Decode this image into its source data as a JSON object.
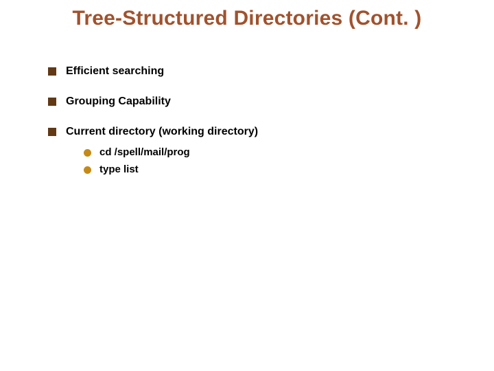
{
  "title": "Tree-Structured Directories (Cont. )",
  "bullets": {
    "b1": "Efficient searching",
    "b2": "Grouping Capability",
    "b3": "Current directory (working directory)",
    "sub1": "cd /spell/mail/prog",
    "sub2": "type list"
  }
}
